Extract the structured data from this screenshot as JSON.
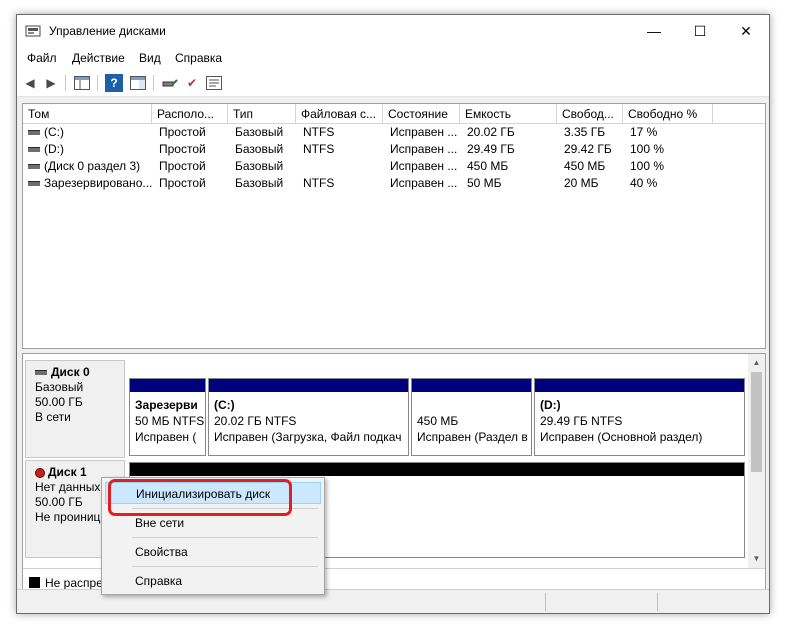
{
  "window": {
    "title": "Управление дисками",
    "controls": {
      "minimize": "—",
      "maximize": "☐",
      "close": "✕"
    }
  },
  "menu": [
    "Файл",
    "Действие",
    "Вид",
    "Справка"
  ],
  "toolbar": {
    "icons": [
      "back-arrow-icon",
      "forward-arrow-icon",
      "console-tree-icon",
      "help-icon",
      "show-pane-icon",
      "connect-disk-icon",
      "check-icon",
      "properties-icon"
    ],
    "glyphs": {
      "back": "◀",
      "forward": "▶",
      "help": "?",
      "check": "✔"
    }
  },
  "volume_list": {
    "columns": [
      "Том",
      "Располо...",
      "Тип",
      "Файловая с...",
      "Состояние",
      "Емкость",
      "Свобод...",
      "Свободно %"
    ],
    "rows": [
      {
        "name": "(C:)",
        "layout": "Простой",
        "type": "Базовый",
        "fs": "NTFS",
        "status": "Исправен ...",
        "capacity": "20.02 ГБ",
        "free": "3.35 ГБ",
        "free_pct": "17 %"
      },
      {
        "name": "(D:)",
        "layout": "Простой",
        "type": "Базовый",
        "fs": "NTFS",
        "status": "Исправен ...",
        "capacity": "29.49 ГБ",
        "free": "29.42 ГБ",
        "free_pct": "100 %"
      },
      {
        "name": "(Диск 0 раздел 3)",
        "layout": "Простой",
        "type": "Базовый",
        "fs": "",
        "status": "Исправен ...",
        "capacity": "450 МБ",
        "free": "450 МБ",
        "free_pct": "100 %"
      },
      {
        "name": "Зарезервировано...",
        "layout": "Простой",
        "type": "Базовый",
        "fs": "NTFS",
        "status": "Исправен ...",
        "capacity": "50 МБ",
        "free": "20 МБ",
        "free_pct": "40 %"
      }
    ]
  },
  "disk0": {
    "name": "Диск 0",
    "type": "Базовый",
    "size": "50.00 ГБ",
    "state": "В сети",
    "partitions": [
      {
        "title": "Зарезерви",
        "line2": "50 МБ NTFS",
        "line3": "Исправен ("
      },
      {
        "title": "(C:)",
        "line2": "20.02 ГБ NTFS",
        "line3": "Исправен (Загрузка, Файл подкач"
      },
      {
        "title": "",
        "line2": "450 МБ",
        "line3": "Исправен (Раздел в"
      },
      {
        "title": "(D:)",
        "line2": "29.49 ГБ NTFS",
        "line3": "Исправен (Основной раздел)"
      }
    ]
  },
  "disk1": {
    "name": "Диск 1",
    "type": "Нет данных",
    "size": "50.00 ГБ",
    "state": "Не проинициализирован"
  },
  "legend": {
    "label": "Не распределена"
  },
  "context_menu": {
    "items": [
      "Инициализировать диск",
      "Вне сети",
      "Свойства",
      "Справка"
    ],
    "highlighted_index": 0,
    "highlight_color": "#cce8ff",
    "ring_color": "#e02020"
  },
  "colors": {
    "partition_header": "#00007f",
    "unallocated": "#000000"
  }
}
